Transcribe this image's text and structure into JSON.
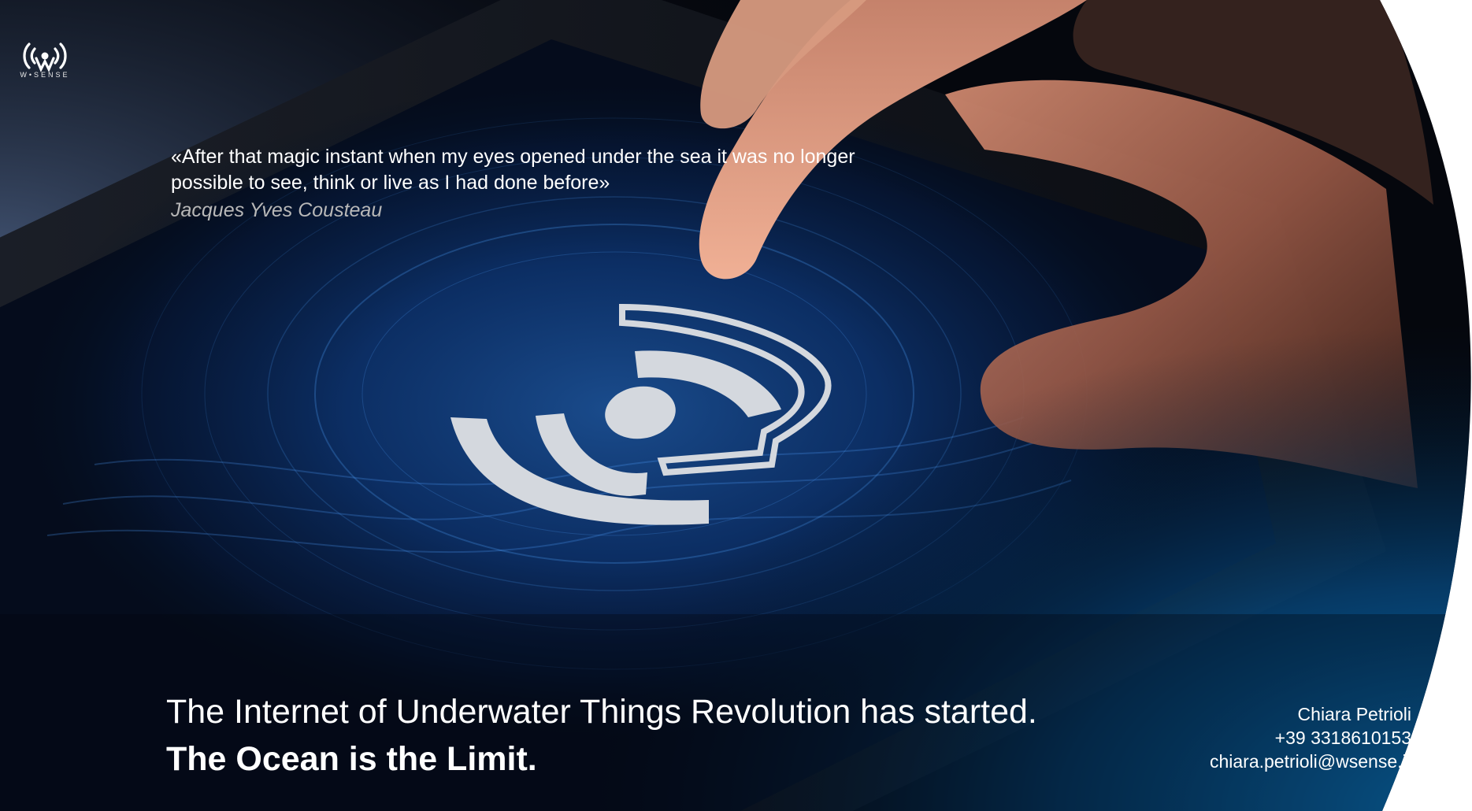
{
  "brand": {
    "name": "W-SENSE",
    "logo_caption": "W•SENSE"
  },
  "quote": {
    "text": "«After that magic instant when my eyes opened under the sea it was no longer possible to see, think or live as I had done before»",
    "author": "Jacques Yves Cousteau"
  },
  "headline": "The Internet of Underwater Things Revolution has started.",
  "tagline": "The Ocean is the Limit.",
  "contact": {
    "name": "Chiara Petrioli",
    "phone": "+39 3318610153",
    "email": "chiara.petrioli@wsense.it"
  },
  "colors": {
    "background": "#05070d",
    "screen_glow": "#1a5fa8",
    "accent_blue": "#0a7fd0",
    "text": "#ffffff",
    "author_text": "#b8b8b8",
    "skin": "#b86e58"
  }
}
